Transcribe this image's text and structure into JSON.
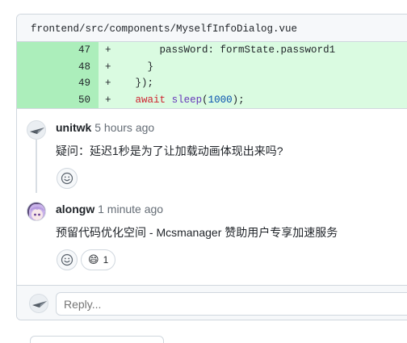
{
  "file": {
    "path": "frontend/src/components/MyselfInfoDialog.vue"
  },
  "diff": {
    "lines": [
      {
        "num": "47",
        "sign": "+",
        "indent": "        ",
        "text": "passWord: formState.password1"
      },
      {
        "num": "48",
        "sign": "+",
        "indent": "      ",
        "text": "}"
      },
      {
        "num": "49",
        "sign": "+",
        "indent": "    ",
        "text": "});"
      },
      {
        "num": "50",
        "sign": "+",
        "indent": "    ",
        "keyword": "await",
        "fn": "sleep",
        "paren_open": "(",
        "number": "1000",
        "paren_close": ");"
      }
    ]
  },
  "comments": [
    {
      "author": "unitwk",
      "time": "5 hours ago",
      "body": "疑问：延迟1秒是为了让加载动画体现出来吗?",
      "avatar_icon": "paper-plane-avatar-icon"
    },
    {
      "author": "alongw",
      "time": "1 minute ago",
      "body": "预留代码优化空间 - Mcsmanager 赞助用户专享加速服务",
      "avatar_icon": "anime-character-avatar",
      "reaction": {
        "emoji": "😄",
        "count": "1"
      }
    }
  ],
  "reply": {
    "placeholder": "Reply..."
  },
  "icons": {
    "add_reaction": "smiley-icon"
  },
  "colors": {
    "added_line_bg": "#dafbe1",
    "added_num_bg": "#aceebb",
    "keyword": "#cf222e",
    "function": "#6639ba",
    "number": "#0550ae"
  }
}
